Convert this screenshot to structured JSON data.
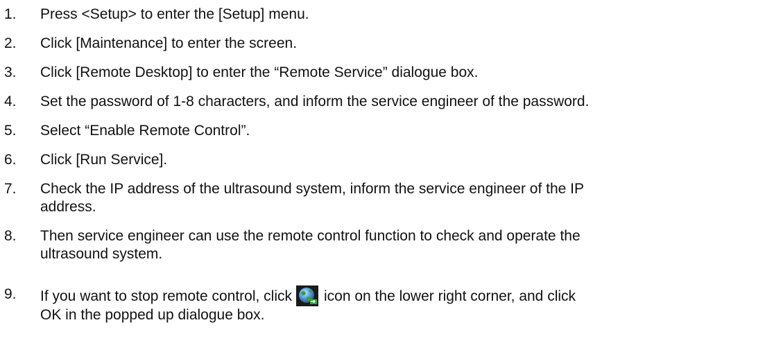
{
  "steps": [
    {
      "num": "1.",
      "text": "Press <Setup> to enter the [Setup] menu."
    },
    {
      "num": "2.",
      "text": "Click [Maintenance] to enter the screen."
    },
    {
      "num": "3.",
      "text": "Click [Remote Desktop] to enter the “Remote Service” dialogue box."
    },
    {
      "num": "4.",
      "text": "Set the password of 1-8 characters, and inform the service engineer of the password."
    },
    {
      "num": "5.",
      "text": "Select “Enable Remote Control”."
    },
    {
      "num": "6.",
      "text": "Click [Run Service]."
    },
    {
      "num": "7.",
      "line1": "Check the IP address of the ultrasound system, inform the service engineer of the IP",
      "line2": "address."
    },
    {
      "num": "8.",
      "line1": "Then service engineer can use the remote control function to check and operate the",
      "line2": "ultrasound system."
    },
    {
      "num": "9.",
      "before_icon": "If you want to stop remote control, click",
      "after_icon": "icon on the lower right corner, and click",
      "line2": "OK in the popped up dialogue box.",
      "icon": "remote-service-globe-icon"
    }
  ]
}
